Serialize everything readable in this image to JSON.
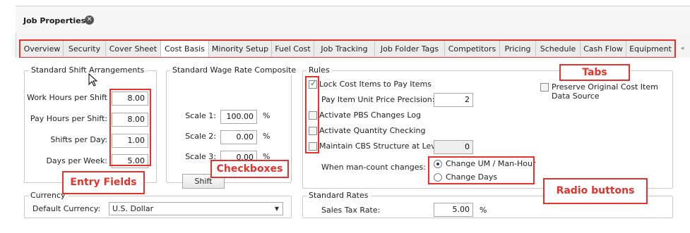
{
  "window": {
    "title": "Job Properties"
  },
  "tabs": [
    {
      "label": "Overview",
      "active": false
    },
    {
      "label": "Security",
      "active": false
    },
    {
      "label": "Cover Sheet",
      "active": false
    },
    {
      "label": "Cost Basis",
      "active": true
    },
    {
      "label": "Minority Setup",
      "active": false
    },
    {
      "label": "Fuel Cost",
      "active": false
    },
    {
      "label": "Job Tracking",
      "active": false
    },
    {
      "label": "Job Folder Tags",
      "active": false
    },
    {
      "label": "Competitors",
      "active": false
    },
    {
      "label": "Pricing",
      "active": false
    },
    {
      "label": "Schedule",
      "active": false
    },
    {
      "label": "Cash Flow",
      "active": false
    },
    {
      "label": "Equipment",
      "active": false
    }
  ],
  "shift": {
    "title": "Standard Shift Arrangements",
    "work_hours_label": "Work Hours per Shift",
    "work_hours": "8.00",
    "pay_hours_label": "Pay Hours per Shift:",
    "pay_hours": "8.00",
    "shifts_label": "Shifts per Day:",
    "shifts": "1.00",
    "days_label": "Days per Week:",
    "days": "5.00"
  },
  "wage": {
    "title": "Standard Wage Rate Composite",
    "scale1_label": "Scale 1:",
    "scale1": "100.00",
    "scale2_label": "Scale 2:",
    "scale2": "0.00",
    "scale3_label": "Scale 3:",
    "scale3": "0.00",
    "percent": "%",
    "shift_button": "Shift"
  },
  "rules": {
    "title": "Rules",
    "lock_label": "Lock Cost Items to Pay Items",
    "lock_checked": true,
    "precision_label": "Pay Item Unit Price Precision:",
    "precision": "2",
    "pbs_label": "Activate PBS Changes Log",
    "quantity_label": "Activate Quantity Checking",
    "cbs_label": "Maintain CBS Structure at Level:",
    "cbs_level": "0",
    "mancount_label": "When man-count changes:",
    "radio_um": "Change UM / Man-Hour",
    "radio_days": "Change Days",
    "preserve_label_1": "Preserve Original Cost Item",
    "preserve_label_2": "Data Source"
  },
  "currency": {
    "title": "Currency",
    "default_label": "Default Currency:",
    "default_value": "U.S. Dollar"
  },
  "rates": {
    "title": "Standard Rates",
    "sales_tax_label": "Sales Tax Rate:",
    "sales_tax": "5.00",
    "percent": "%"
  },
  "annotations": {
    "tabs": "Tabs",
    "checkboxes": "Checkboxes",
    "entry_fields": "Entry Fields",
    "radio_buttons": "Radio buttons"
  },
  "colors": {
    "highlight": "#e5322b",
    "accent": "#1a5fb4"
  }
}
